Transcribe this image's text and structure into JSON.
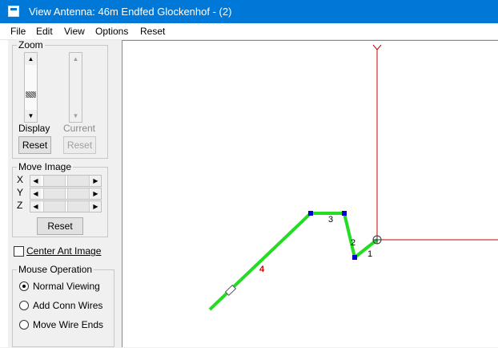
{
  "window": {
    "title": "View Antenna: 46m Endfed Glockenhof - (2)"
  },
  "menu": [
    "File",
    "Edit",
    "View",
    "Options",
    "Reset"
  ],
  "zoom": {
    "legend": "Zoom",
    "display_label": "Display",
    "current_label": "Current",
    "reset_display": "Reset",
    "reset_current": "Reset"
  },
  "move_image": {
    "legend": "Move Image",
    "axes": [
      "X",
      "Y",
      "Z"
    ],
    "reset": "Reset"
  },
  "center_ant_image": {
    "label": "Center Ant Image",
    "checked": false
  },
  "mouse_operation": {
    "legend": "Mouse Operation",
    "options": [
      {
        "label": "Normal Viewing",
        "selected": true
      },
      {
        "label": "Add Conn Wires",
        "selected": false
      },
      {
        "label": "Move Wire Ends",
        "selected": false
      }
    ]
  },
  "canvas": {
    "wire_labels": [
      "1",
      "2",
      "3",
      "4"
    ],
    "axis_color": "#cc0000",
    "wire_color": "#22dd22",
    "node_color": "#0000cc",
    "highlight_label_color": "#cc0000"
  }
}
